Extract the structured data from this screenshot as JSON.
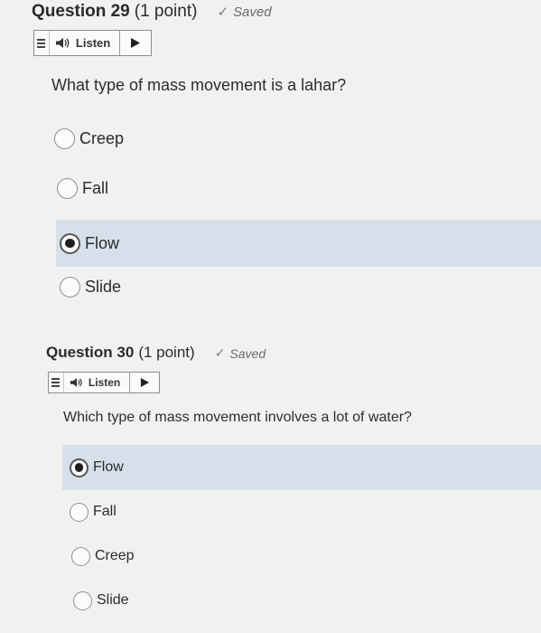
{
  "questions": [
    {
      "title": "Question 29",
      "points": "(1 point)",
      "saved": "Saved",
      "listen": "Listen",
      "prompt": "What type of mass movement is a lahar?",
      "options": [
        {
          "label": "Creep",
          "selected": false
        },
        {
          "label": "Fall",
          "selected": false
        },
        {
          "label": "Flow",
          "selected": true
        },
        {
          "label": "Slide",
          "selected": false
        }
      ]
    },
    {
      "title": "Question 30",
      "points": "(1 point)",
      "saved": "Saved",
      "listen": "Listen",
      "prompt": "Which type of mass movement involves a lot of water?",
      "options": [
        {
          "label": "Flow",
          "selected": true
        },
        {
          "label": "Fall",
          "selected": false
        },
        {
          "label": "Creep",
          "selected": false
        },
        {
          "label": "Slide",
          "selected": false
        }
      ]
    }
  ],
  "colors": {
    "background": "#f1f1ef",
    "selected_row": "#d7e0ea",
    "text": "#2b2b2b"
  }
}
